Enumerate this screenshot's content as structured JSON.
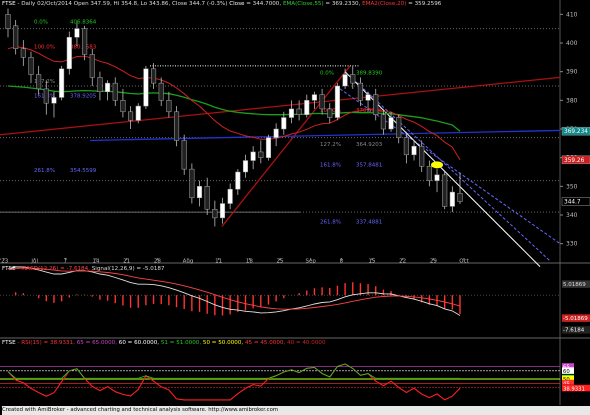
{
  "header": {
    "symbol": "FTSE",
    "text": " - Daily 02/Oct/2014 Open 347.59, Hi 354.8, Lo 343.86, Close 344.7 (-0.3%) ",
    "close_label": "Close",
    "close_value": " = 344.7000, ",
    "ema55_label": "EMA(Close,55)",
    "ema55_value": " = 369.2330, ",
    "ema20_label": "EMA2(Close,20)",
    "ema20_value": " = 359.2596"
  },
  "macd_header": {
    "symbol": "FTSE",
    "label": " - MACD(12,26) = -7.6184, ",
    "signal_label": "Signal(12,26,9)",
    "signal_value": " = -5.0187"
  },
  "rsi_header": {
    "symbol": "FTSE",
    "label": " - RSI(15) = 38.9331, ",
    "levels": [
      "65 = 65.0000, ",
      "60 = 60.0000, ",
      "51 = 51.0000, ",
      "50 = 50.0000, ",
      "45 = 45.0000, ",
      "40 = 40.0000"
    ]
  },
  "footer": "Created with AmiBroker - advanced charting and technical analysis software. http://www.amibroker.com",
  "colors": {
    "up": "#ffffff",
    "down": "#000000",
    "ema55": "#1b9e1b",
    "ema20": "#cc2222",
    "macd": "#e0e0e0",
    "signal": "#ff4444",
    "rsi": "#ff2020",
    "fib_green": "#22cc22",
    "fib_red": "#ff3030",
    "fib_blue": "#6666ff",
    "trend_dark": "#aa1111",
    "trend_blue": "#2233cc"
  },
  "chart_data": {
    "type": "candlestick",
    "y_axis": {
      "min": 325,
      "max": 415,
      "ticks": [
        330,
        340,
        350,
        360,
        370,
        380,
        390,
        400,
        410
      ]
    },
    "x_tick_labels": [
      "'23",
      "Jul",
      "7",
      "14",
      "21",
      "28",
      "Aug",
      "11",
      "18",
      "25",
      "Sep",
      "8",
      "15",
      "22",
      "29",
      "Oct"
    ],
    "price_labels": [
      {
        "text": "369.234",
        "value": 369.234,
        "bg": "#0e8a8a"
      },
      {
        "text": "359.26",
        "value": 359.26,
        "bg": "#cc2020"
      },
      {
        "text": "344.7",
        "value": 344.7,
        "bg": "#000000"
      }
    ],
    "candles": [
      [
        410,
        412,
        402,
        405
      ],
      [
        406,
        408,
        396,
        398
      ],
      [
        398,
        401,
        392,
        395
      ],
      [
        395,
        397,
        386,
        389
      ],
      [
        389,
        392,
        382,
        384
      ],
      [
        384,
        387,
        375,
        379
      ],
      [
        379,
        383,
        374,
        381
      ],
      [
        381,
        392,
        380,
        391
      ],
      [
        391,
        404,
        389,
        402
      ],
      [
        402,
        407,
        399,
        405
      ],
      [
        405,
        406,
        394,
        396
      ],
      [
        396,
        398,
        385,
        388
      ],
      [
        388,
        390,
        380,
        383
      ],
      [
        383,
        387,
        380,
        386
      ],
      [
        386,
        388,
        378,
        380
      ],
      [
        380,
        384,
        374,
        376
      ],
      [
        376,
        378,
        370,
        373
      ],
      [
        373,
        379,
        372,
        378
      ],
      [
        378,
        392,
        377,
        391
      ],
      [
        391,
        393,
        384,
        386
      ],
      [
        386,
        388,
        378,
        380
      ],
      [
        380,
        383,
        374,
        376
      ],
      [
        376,
        378,
        364,
        366
      ],
      [
        366,
        368,
        354,
        356
      ],
      [
        356,
        358,
        344,
        346
      ],
      [
        346,
        352,
        343,
        350
      ],
      [
        350,
        353,
        340,
        342
      ],
      [
        342,
        345,
        336,
        339
      ],
      [
        339,
        346,
        337,
        344
      ],
      [
        344,
        351,
        342,
        349
      ],
      [
        349,
        356,
        347,
        355
      ],
      [
        355,
        361,
        353,
        359
      ],
      [
        359,
        364,
        356,
        362
      ],
      [
        362,
        366,
        358,
        360
      ],
      [
        360,
        368,
        359,
        367
      ],
      [
        367,
        372,
        364,
        370
      ],
      [
        370,
        376,
        368,
        374
      ],
      [
        374,
        380,
        372,
        377
      ],
      [
        377,
        380,
        373,
        375
      ],
      [
        375,
        382,
        374,
        380
      ],
      [
        380,
        383,
        377,
        382
      ],
      [
        382,
        384,
        375,
        377
      ],
      [
        377,
        379,
        372,
        374
      ],
      [
        374,
        386,
        373,
        385
      ],
      [
        385,
        391,
        384,
        389
      ],
      [
        389,
        392,
        384,
        386
      ],
      [
        386,
        388,
        378,
        380
      ],
      [
        380,
        383,
        376,
        382
      ],
      [
        382,
        384,
        373,
        375
      ],
      [
        375,
        377,
        368,
        370
      ],
      [
        370,
        376,
        369,
        374
      ],
      [
        374,
        375,
        365,
        367
      ],
      [
        367,
        369,
        358,
        361
      ],
      [
        361,
        366,
        359,
        364
      ],
      [
        364,
        366,
        355,
        357
      ],
      [
        357,
        359,
        350,
        352
      ],
      [
        352,
        356,
        348,
        354
      ],
      [
        354,
        355,
        342,
        343
      ],
      [
        343,
        350,
        341,
        348
      ],
      [
        347.59,
        354.8,
        343.86,
        344.7
      ]
    ],
    "ema55": [
      385,
      384.8,
      384.6,
      384.3,
      384,
      383.6,
      383.2,
      383,
      383.1,
      383.3,
      383.4,
      383.3,
      383.2,
      383.1,
      383,
      382.7,
      382.4,
      382.2,
      382.5,
      382.6,
      382.5,
      382.3,
      381.8,
      381.1,
      380.2,
      379.5,
      378.6,
      377.6,
      376.8,
      376.2,
      375.8,
      375.5,
      375.3,
      375.1,
      375,
      375,
      375,
      375.1,
      375.1,
      375.2,
      375.4,
      375.4,
      375.3,
      375.5,
      375.7,
      375.8,
      375.7,
      375.7,
      375.6,
      375.4,
      375.3,
      375,
      374.6,
      374.3,
      373.9,
      373.3,
      372.8,
      372.1,
      371.4,
      369.2
    ],
    "ema20": [
      398,
      398.7,
      398.4,
      397.6,
      396.4,
      394.9,
      393.6,
      393.4,
      394.3,
      395.3,
      395.4,
      394.7,
      393.6,
      392.9,
      391.7,
      390.2,
      388.6,
      387.6,
      387.9,
      387.8,
      387.1,
      386.0,
      384.3,
      382.3,
      379.9,
      378.0,
      375.5,
      372.9,
      370.8,
      369.3,
      368.5,
      367.6,
      367.1,
      366.4,
      366.4,
      366.8,
      367.4,
      368.3,
      368.9,
      369.9,
      371.1,
      371.8,
      372.0,
      373.3,
      374.9,
      376.0,
      376.4,
      376.9,
      376.8,
      376.1,
      375.9,
      374.7,
      373.4,
      372.4,
      370.9,
      369.1,
      367.7,
      365.4,
      363.7,
      359.26
    ],
    "macd": {
      "range": [
        -9,
        6
      ],
      "ticks_labels": [
        "5.01869",
        "-5.01869",
        "-7.6184"
      ]
    },
    "rsi": {
      "range": [
        20,
        90
      ],
      "levels": [
        65,
        60,
        51,
        50,
        45,
        40
      ],
      "current": 38.9331,
      "level_labels": [
        "65",
        "60",
        "51",
        "50",
        "45",
        "40",
        "38.9331"
      ],
      "level_colors": [
        "#cc44cc",
        "#ffffff",
        "#22cc22",
        "#ffff00",
        "#ff3333",
        "#cc2222",
        "#ff2020"
      ]
    },
    "fib_labels": [
      {
        "text": "0.0%",
        "value": "406.8364",
        "color": "#22cc22"
      },
      {
        "text": "100.0%",
        "value": "380.5583",
        "color": "#ff3030"
      },
      {
        "text": "127.2%",
        "value": "",
        "color": "#888888"
      },
      {
        "text": "161.8%",
        "value": "378.9205",
        "color": "#6666ff"
      },
      {
        "text": "261.8%",
        "value": "354.5599",
        "color": "#6666ff"
      },
      {
        "text": "0.0%",
        "value": "389.8390",
        "color": "#22cc22"
      },
      {
        "text": "100.0%",
        "value": "370.1086",
        "color": "#ff3030"
      },
      {
        "text": "127.2%",
        "value": "364.9203",
        "color": "#888888"
      },
      {
        "text": "161.8%",
        "value": "357.8481",
        "color": "#6666ff"
      },
      {
        "text": "261.8%",
        "value": "337.4881",
        "color": "#6666ff"
      }
    ]
  }
}
